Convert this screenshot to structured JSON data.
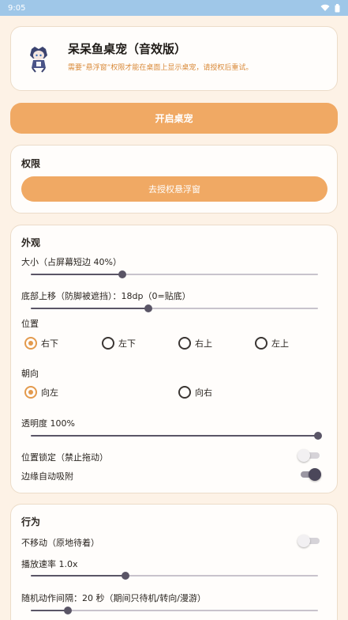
{
  "status": {
    "time": "9:05"
  },
  "header": {
    "title": "呆呆鱼桌宠（音效版）",
    "subtitle": "需要“悬浮窗”权限才能在桌面上显示桌宠，请授权后重试。"
  },
  "main_button": "开启桌宠",
  "permission": {
    "title": "权限",
    "button": "去授权悬浮窗"
  },
  "appearance": {
    "title": "外观",
    "size_label": "大小（占屏幕短边 40%）",
    "size_value": 0.32,
    "offset_label": "底部上移（防脚被遮挡）：18dp（0=贴底）",
    "offset_value": 0.41,
    "position_label": "位置",
    "position_options": [
      "右下",
      "左下",
      "右上",
      "左上"
    ],
    "position_selected": "右下",
    "facing_label": "朝向",
    "facing_options": [
      "向左",
      "向右"
    ],
    "facing_selected": "向左",
    "opacity_label": "透明度 100%",
    "opacity_value": 1.0,
    "lock_label": "位置锁定（禁止拖动）",
    "lock_on": false,
    "snap_label": "边缘自动吸附",
    "snap_on": true
  },
  "behavior": {
    "title": "行为",
    "stay_label": "不移动（原地待着）",
    "stay_on": false,
    "speed_label": "播放速率 1.0x",
    "speed_value": 0.33,
    "interval_label": "随机动作间隔：20 秒（期间只待机/转向/漫游）",
    "interval_value": 0.13
  },
  "colors": {
    "accent": "#f0a964",
    "background": "#fdf2e6",
    "statusbar": "#9fc7e8"
  }
}
